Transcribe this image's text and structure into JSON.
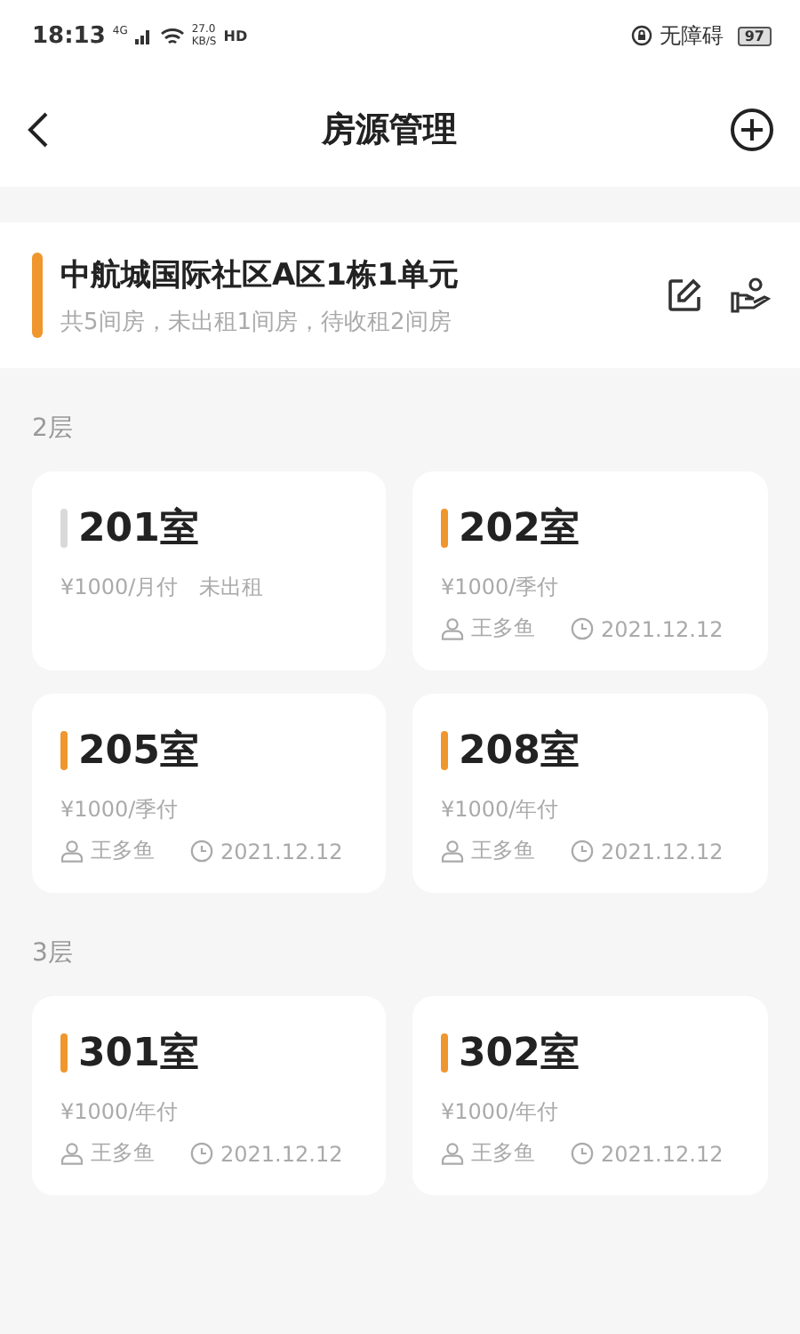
{
  "status_bar": {
    "time": "18:13",
    "network": "4G",
    "speed_value": "27.0",
    "speed_unit": "KB/S",
    "hd": "HD",
    "accessibility": "无障碍",
    "battery": "97"
  },
  "nav": {
    "title": "房源管理"
  },
  "building": {
    "name": "中航城国际社区A区1栋1单元",
    "summary": "共5间房，未出租1间房，待收租2间房"
  },
  "floors": [
    {
      "label": "2层",
      "rooms": [
        {
          "name": "201室",
          "color": "#d9d9d9",
          "price": "¥1000/月付",
          "status": "未出租"
        },
        {
          "name": "202室",
          "color": "#f0962e",
          "price": "¥1000/季付",
          "tenant": "王多鱼",
          "date": "2021.12.12"
        },
        {
          "name": "205室",
          "color": "#f0962e",
          "price": "¥1000/季付",
          "tenant": "王多鱼",
          "date": "2021.12.12"
        },
        {
          "name": "208室",
          "color": "#f0962e",
          "price": "¥1000/年付",
          "tenant": "王多鱼",
          "date": "2021.12.12"
        }
      ]
    },
    {
      "label": "3层",
      "rooms": [
        {
          "name": "301室",
          "color": "#f0962e",
          "price": "¥1000/年付",
          "tenant": "王多鱼",
          "date": "2021.12.12"
        },
        {
          "name": "302室",
          "color": "#f0962e",
          "price": "¥1000/年付",
          "tenant": "王多鱼",
          "date": "2021.12.12"
        }
      ]
    }
  ]
}
